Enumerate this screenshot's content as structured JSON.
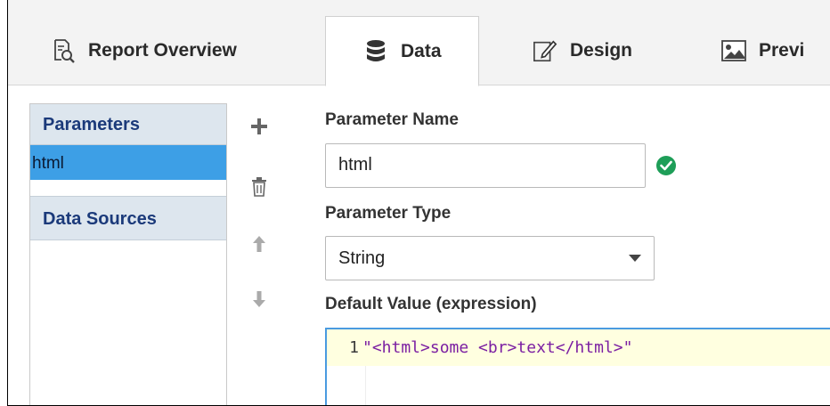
{
  "tabs": [
    {
      "label": "Report Overview",
      "icon": "report-overview-icon",
      "active": false
    },
    {
      "label": "Data",
      "icon": "database-icon",
      "active": true
    },
    {
      "label": "Design",
      "icon": "design-edit-icon",
      "active": false
    },
    {
      "label": "Previ",
      "icon": "image-preview-icon",
      "active": false
    }
  ],
  "sidebar": {
    "parameters_header": "Parameters",
    "parameters": [
      "html"
    ],
    "data_sources_header": "Data Sources"
  },
  "actions": [
    {
      "name": "add",
      "icon": "plus-icon"
    },
    {
      "name": "delete",
      "icon": "trash-icon"
    },
    {
      "name": "move-up",
      "icon": "arrow-up-icon"
    },
    {
      "name": "move-down",
      "icon": "arrow-down-icon"
    }
  ],
  "form": {
    "name_label": "Parameter Name",
    "name_value": "html",
    "type_label": "Parameter Type",
    "type_value": "String",
    "default_label": "Default Value (expression)",
    "line_number": "1",
    "default_code": "\"<html>some <br>text</html>\""
  },
  "colors": {
    "selected_row": "#3d9fe6",
    "header_bg": "#dde6ee",
    "header_text": "#1b3a7a",
    "valid_check": "#1e9e58",
    "editor_border": "#4a9be0",
    "editor_line_bg": "#ffffe0",
    "code_text": "#7b1fa2"
  }
}
